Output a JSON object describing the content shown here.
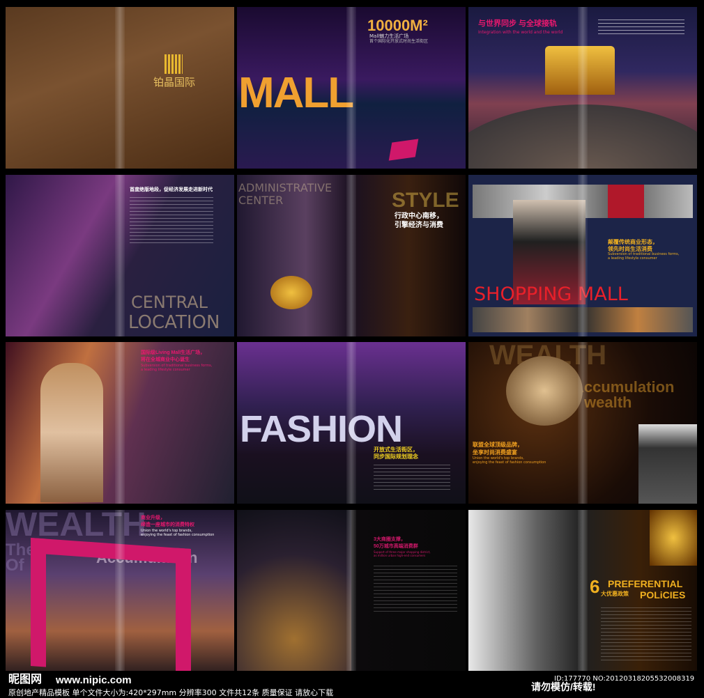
{
  "spreads": {
    "s1": {
      "logo_text": "铂晶国际",
      "logo_icon": "building-logo-icon"
    },
    "s2": {
      "area": "10000M²",
      "sub1": "Mall魅力生活广场",
      "sub2": "首个国际化开放式时尚生活街区",
      "word": "MALL"
    },
    "s3": {
      "title": "与世界同步  与全球接轨",
      "subtitle": "Integration with the world and the world"
    },
    "s4": {
      "title": "首度绝版地段，促经济发展走进新时代",
      "word1": "CENTRAL",
      "word2": "LOCATION"
    },
    "s5": {
      "word1": "ADMINISTRATIVE",
      "word2": "CENTER",
      "title1": "行政中心南移，",
      "title2": "引擎经济与消费",
      "word3": "STYLE"
    },
    "s6": {
      "title1": "颠覆传统商业形态，",
      "title2": "领先时尚生活消费",
      "en1": "Subversion of traditional business forms,",
      "en2": "a leading lifestyle consumer",
      "word": "SHOPPING MALL"
    },
    "s7": {
      "title1": "国际级Living Mall生活广场，",
      "title2": "将在全城商业中心诞生",
      "en1": "Subversion of traditional business forms,",
      "en2": "a leading lifestyle consumer"
    },
    "s8": {
      "word": "FASHION",
      "title1": "开放式生活街区，",
      "title2": "同步国际规划理念"
    },
    "s9": {
      "word1": "WEALTH",
      "word2": "Accumulation",
      "word3": "wealth",
      "title1": "联盟全球顶级品牌，",
      "title2": "坐享时尚消费盛宴",
      "en1": "Union the world's top brands,",
      "en2": "enjoying the feast of fashion consumption"
    },
    "s10": {
      "word1": "WEALTH",
      "word2": "The",
      "word3": "Of",
      "word4": "Accumulation",
      "title1": "商业升级，",
      "title2": "缔造一座城市的消费特权",
      "en1": "Union the world's top brands,",
      "en2": "enjoying the feast of fashion consumption"
    },
    "s11": {
      "title1": "3大商圈支撑，",
      "title2": "50万城市高端消费群",
      "en1": "Support of three major shopping district,",
      "en2": "as million urban high-end consumers"
    },
    "s12": {
      "number": "6",
      "title": "大优惠政策",
      "en1": "PREFERENTIAL",
      "en2": "POLiCIES"
    }
  },
  "footer": {
    "site_logo": "昵图网",
    "url": "www.nipic.com",
    "id": "ID:177770 NO:20120318205532008319",
    "warning": "请勿模仿/转载!",
    "desc": "原创地产精品模板 单个文件大小为:420*297mm 分辨率300 文件共12条 质量保证 请放心下载"
  },
  "colors": {
    "accent_pink": "#e8186e",
    "accent_gold": "#f0b020",
    "bg": "#000000"
  }
}
